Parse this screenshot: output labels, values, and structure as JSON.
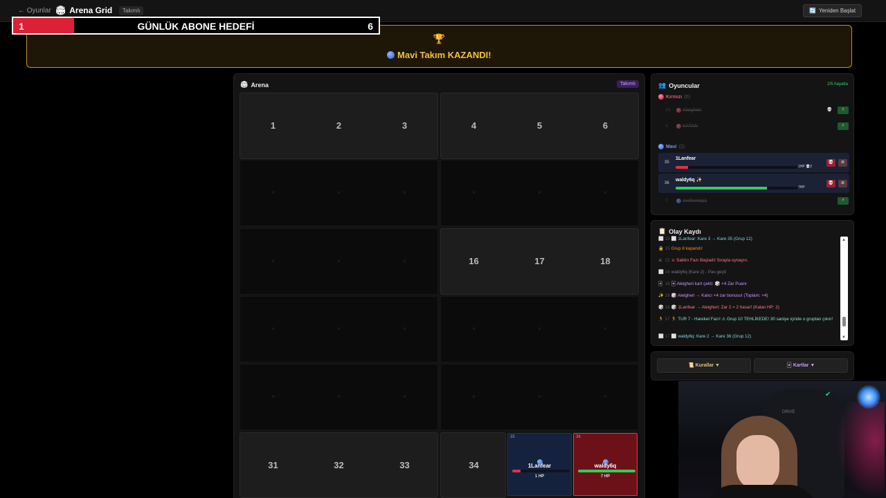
{
  "topbar": {
    "back_label": "← Oyunlar",
    "app_icon": "🏟",
    "app_title": "Arena Grid",
    "mode_tag": "Takımlı",
    "restart_icon": "🔄",
    "restart_label": "Yeniden Başlat"
  },
  "goal": {
    "current": "1",
    "title": "GÜNLÜK ABONE HEDEFİ",
    "target": "6",
    "progress_fraction": 0.167,
    "fill_color": "#dc2036"
  },
  "winner": {
    "trophy_icon": "🏆",
    "text": "Mavi Takım KAZANDI!"
  },
  "arena": {
    "icon": "🏟",
    "title": "Arena",
    "mode_tag": "Takımlı",
    "cells_row1": [
      "1",
      "2",
      "3",
      "4",
      "5",
      "6"
    ],
    "cells_row3": [
      "16",
      "17",
      "18"
    ],
    "cells_row6": [
      "31",
      "32",
      "33",
      "34"
    ],
    "dead_mark": "×",
    "player_cells": [
      {
        "num": "35",
        "name": "1Lanfear",
        "hp": "1 HP",
        "hp_fraction": 0.14,
        "team": "blue"
      },
      {
        "num": "36",
        "name": "waldy6q",
        "hp": "7 HP",
        "hp_fraction": 1.0,
        "team": "blue"
      }
    ]
  },
  "players": {
    "icon": "👥",
    "title": "Oyuncular",
    "alive": "2/5 hayatta",
    "red_team": {
      "label": "Kırmızı",
      "count": "(0)",
      "color": "#e0566a"
    },
    "blue_team": {
      "label": "Mavi",
      "count": "(2)",
      "color": "#5c9bff"
    },
    "red_rows": [
      {
        "num": "34",
        "name": "Aleigheri",
        "skull": "💀",
        "action": "⚡"
      },
      {
        "num": "4",
        "name": "KATAN",
        "action": "⚡"
      }
    ],
    "blue_rows": [
      {
        "num": "35",
        "name": "1Lanfear",
        "hp": "1HP",
        "hp_fraction": 0.1,
        "bar_color": "#e0304a",
        "extra": "💀2"
      },
      {
        "num": "36",
        "name": "waldy6q",
        "badge": "✨",
        "hp": "7HP",
        "hp_fraction": 0.75,
        "bar_color": "#2fcf5a"
      }
    ],
    "blue_dead_rows": [
      {
        "num": "2",
        "name": "1willowisp1",
        "action": "⚡"
      }
    ],
    "btn_skull": "💀",
    "btn_kick": "⊘"
  },
  "log": {
    "icon": "📋",
    "title": "Olay Kaydı",
    "items": [
      {
        "icon": "⬜",
        "time": "15",
        "text": "⬜ 1Lanfear: Kare 3 → Kare 35 (Grup 12)",
        "color": "#7fd4e6"
      },
      {
        "icon": "🔒",
        "time": "15",
        "text": "Grup 8 kapandı!",
        "color": "#f0902a"
      },
      {
        "icon": "⚔",
        "time": "15",
        "text": "⚔ Saldırı Fazı Başladı! Sırayla oynayın.",
        "color": "#ff7a8a"
      },
      {
        "icon": "⬜",
        "time": "16",
        "text": "waldy6q (Kare 2) - Pas geçti",
        "color": "#7a7a7a"
      },
      {
        "icon": "🃏",
        "time": "16",
        "text": "🃏 Aleigheri kart çekti: 🎲 +4 Zar Puanı",
        "color": "#c79bff"
      },
      {
        "icon": "✨",
        "time": "16",
        "text": "🎲 Aleigheri → Kalıcı +4 zar bonusu! (Toplam: +4)",
        "color": "#c79bff"
      },
      {
        "icon": "🎲",
        "time": "16",
        "text": "🎲 1Lanfear → Aleigheri: Zar 2 = 2 hasar! (Kalan HP: 2)",
        "color": "#ff7a8a"
      },
      {
        "icon": "🏃",
        "time": "17",
        "text": "🏃 TUR 7 - Hareket Fazı! ⚠ Grup 10 TEHLİKEDE! 30 saniye içinde o gruptan çıkın!",
        "color": "#8fe0d0"
      },
      {
        "icon": "⬜",
        "time": "17",
        "text": "⬜ waldy6q: Kare 2 → Kare 36 (Grup 12)",
        "color": "#7fd4e6"
      }
    ],
    "scroll_up": "▲",
    "scroll_down": "▼"
  },
  "bottom": {
    "rules_label": "📜 Kurallar ▼",
    "cards_label": "🃏 Kartlar ▼"
  },
  "webcam": {
    "chair_brand": "DRIVE",
    "logo": "✔"
  }
}
